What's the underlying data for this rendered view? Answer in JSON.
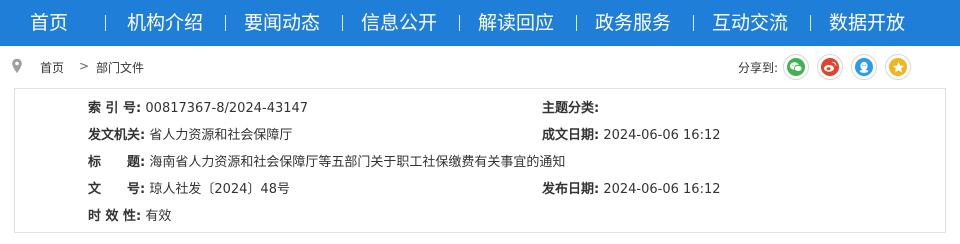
{
  "nav": {
    "items": [
      "首页",
      "机构介绍",
      "要闻动态",
      "信息公开",
      "解读回应",
      "政务服务",
      "互动交流",
      "数据开放"
    ]
  },
  "breadcrumb": {
    "home": "首页",
    "separator": ">",
    "current": "部门文件"
  },
  "share": {
    "label": "分享到:",
    "targets": [
      "wechat-icon",
      "weibo-icon",
      "qq-icon",
      "qzone-icon"
    ]
  },
  "info": {
    "index_label": "索 引 号:",
    "index_value": "00817367-8/2024-43147",
    "category_label": "主题分类:",
    "category_value": "",
    "issuer_label": "发文机关:",
    "issuer_value": "省人力资源和社会保障厅",
    "date_written_label": "成文日期:",
    "date_written_value": "2024-06-06 16:12",
    "title_label": "标　　题:",
    "title_value": "海南省人力资源和社会保障厅等五部门关于职工社保缴费有关事宜的通知",
    "docno_label": "文　　号:",
    "docno_value": "琼人社发〔2024〕48号",
    "date_published_label": "发布日期:",
    "date_published_value": "2024-06-06 16:12",
    "validity_label": "时 效 性:",
    "validity_value": "有效"
  },
  "colors": {
    "nav_bg": "#1f7fd8",
    "wechat": "#3fb34f",
    "weibo": "#e0442d",
    "qq": "#2a9be6",
    "qzone": "#f5b31e"
  }
}
